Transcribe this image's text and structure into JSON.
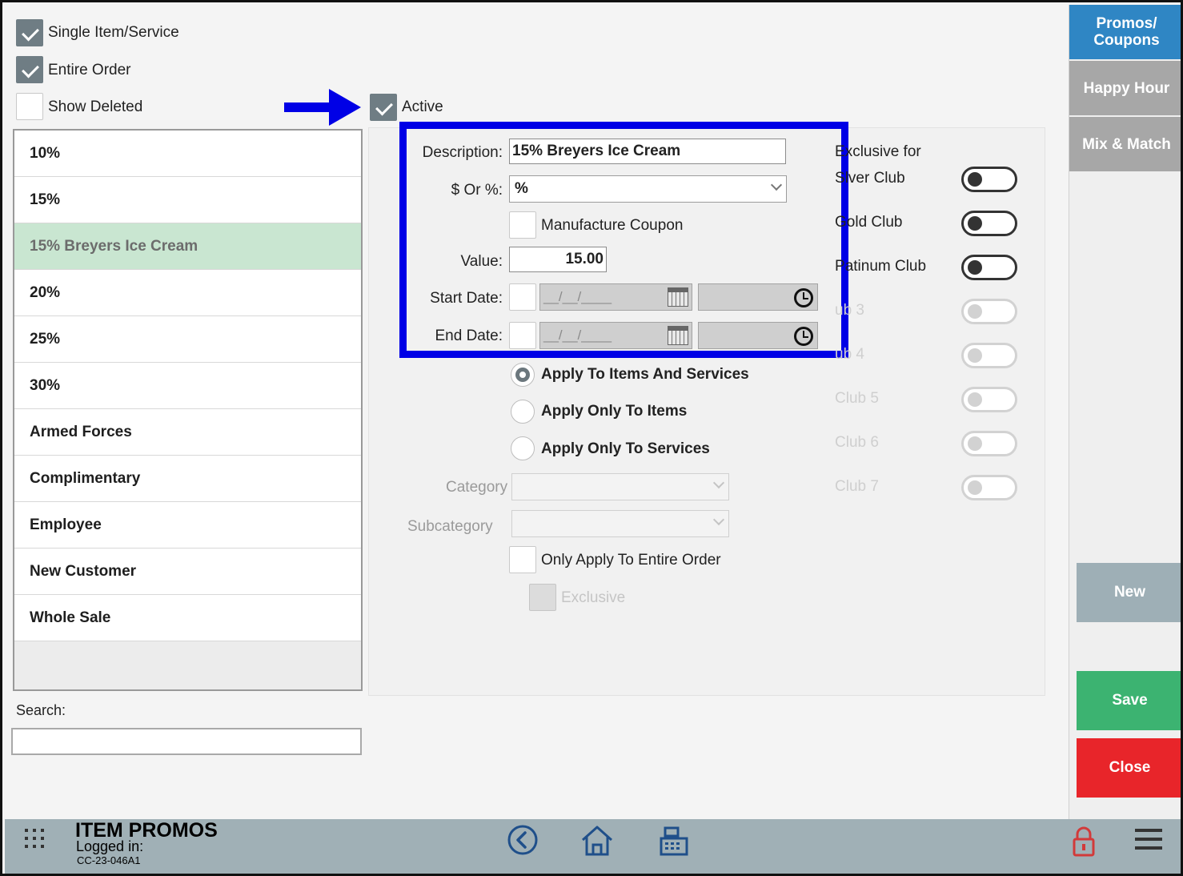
{
  "filters": {
    "single_item_service": {
      "label": "Single Item/Service",
      "checked": true
    },
    "entire_order": {
      "label": "Entire Order",
      "checked": true
    },
    "show_deleted": {
      "label": "Show Deleted",
      "checked": false
    }
  },
  "active": {
    "label": "Active",
    "checked": true
  },
  "promo_list": {
    "items": [
      "10%",
      "15%",
      "15% Breyers Ice Cream",
      "20%",
      "25%",
      "30%",
      "Armed Forces",
      "Complimentary",
      "Employee",
      "New Customer",
      "Whole Sale"
    ],
    "selected": "15% Breyers Ice Cream"
  },
  "search": {
    "label": "Search:",
    "value": ""
  },
  "form": {
    "description_label": "Description:",
    "description_value": "15% Breyers Ice Cream",
    "dollar_or_percent_label": "$ Or %:",
    "dollar_or_percent_value": "%",
    "manufacture_coupon_label": "Manufacture Coupon",
    "value_label": "Value:",
    "value_value": "15.00",
    "start_date_label": "Start Date:",
    "end_date_label": "End Date:",
    "date_placeholder": "__/__/____",
    "apply_options": [
      "Apply To Items And Services",
      "Apply Only To Items",
      "Apply Only To Services"
    ],
    "apply_selected": 0,
    "category_label": "Category",
    "subcategory_label": "Subcategory",
    "only_entire_order_label": "Only Apply To Entire Order",
    "exclusive_label": "Exclusive"
  },
  "clubs": {
    "header_line1": "E",
    "header_line1_rest": "xclusive for",
    "items": [
      {
        "label_prefix": "S",
        "label": "lver Club",
        "enabled": true,
        "on": false
      },
      {
        "label_prefix": "G",
        "label": "old Club",
        "enabled": true,
        "on": false
      },
      {
        "label_prefix": "P",
        "label": "atinum Club",
        "enabled": true,
        "on": false
      },
      {
        "label_prefix": "",
        "label": "ub 3",
        "enabled": false,
        "on": false
      },
      {
        "label_prefix": "",
        "label": "ub 4",
        "enabled": false,
        "on": false
      },
      {
        "label_prefix": "",
        "label": "Club 5",
        "enabled": false,
        "on": false
      },
      {
        "label_prefix": "",
        "label": "Club 6",
        "enabled": false,
        "on": false
      },
      {
        "label_prefix": "",
        "label": "Club 7",
        "enabled": false,
        "on": false
      }
    ]
  },
  "side_tabs": [
    "Promos/ Coupons",
    "Happy Hour",
    "Mix & Match"
  ],
  "side_buttons": {
    "new": "New",
    "save": "Save",
    "close": "Close"
  },
  "bottom_bar": {
    "title": "ITEM PROMOS",
    "logged_in": "Logged in:",
    "terminal_id": "CC-23-046A1"
  },
  "colors": {
    "tab_active": "#2f86c4",
    "tab_inactive": "#a7a7a7",
    "new_button": "#9eafb6",
    "save_button": "#3cb371",
    "close_button": "#e8252a",
    "highlight": "#0000e6",
    "selected_row": "#c9e6d1",
    "bottom_bar": "#a0b0b6"
  },
  "icons": {
    "apps": "grid-icon",
    "back": "back-arrow-icon",
    "home": "home-icon",
    "register": "cash-register-icon",
    "lock": "lock-icon",
    "menu": "hamburger-menu-icon"
  }
}
